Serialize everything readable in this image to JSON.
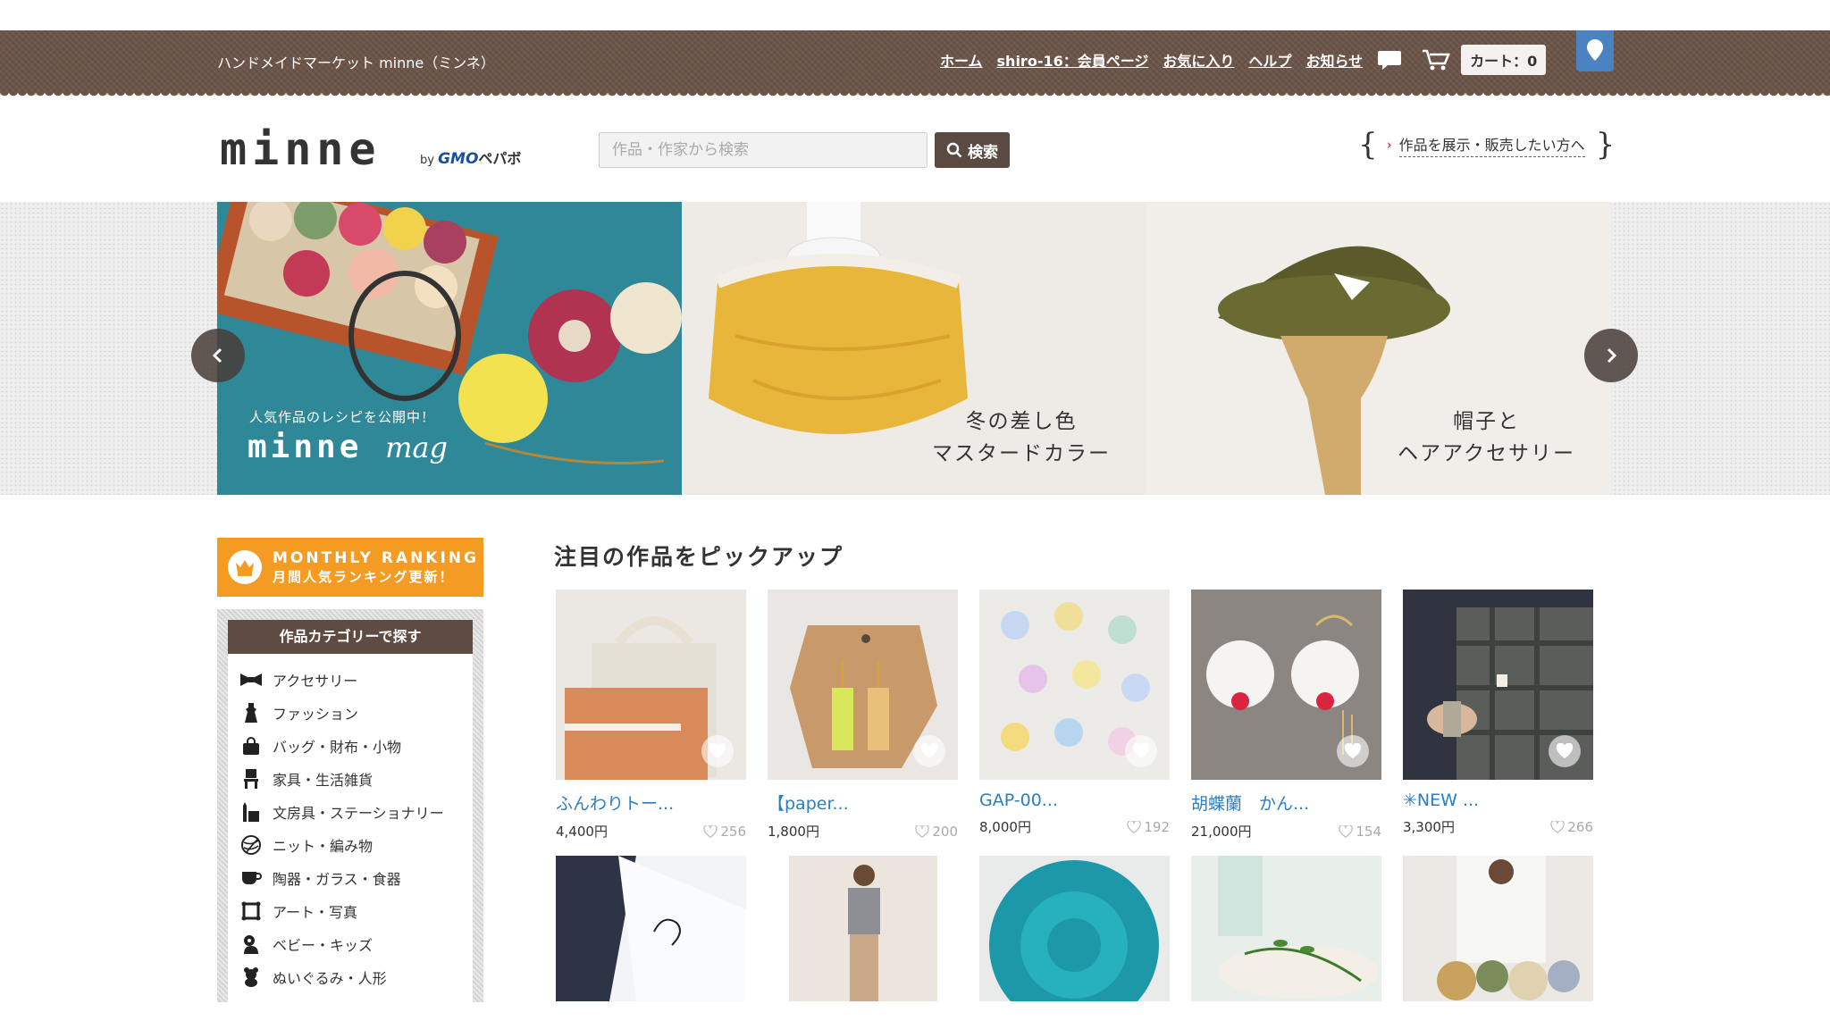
{
  "header": {
    "site_label": "ハンドメイドマーケット minne（ミンネ）",
    "nav": [
      {
        "label": "ホーム"
      },
      {
        "label": "shiro-16：会員ページ"
      },
      {
        "label": "お気に入り"
      },
      {
        "label": "ヘルプ"
      },
      {
        "label": "お知らせ"
      }
    ],
    "cart_label": "カート：0"
  },
  "logo": {
    "text": "minne",
    "by": "by",
    "gmo": "GMO",
    "pepabo": "ペパボ"
  },
  "search": {
    "placeholder": "作品・作家から検索",
    "button_label": "検索"
  },
  "sell_link": {
    "label": "作品を展示・販売したい方へ"
  },
  "hero": {
    "slides": [
      {
        "sub": "人気作品のレシピを公開中！",
        "logo": "minne",
        "logo_script": "mag"
      },
      {
        "caption_line1": "冬の差し色",
        "caption_line2": "マスタードカラー"
      },
      {
        "caption_line1": "帽子と",
        "caption_line2": "ヘアアクセサリー"
      }
    ]
  },
  "ranking_banner": {
    "en": "MONTHLY RANKING",
    "jp": "月間人気ランキング更新！"
  },
  "categories": {
    "title": "作品カテゴリーで探す",
    "items": [
      {
        "label": "アクセサリー",
        "icon": "ribbon-icon"
      },
      {
        "label": "ファッション",
        "icon": "dress-icon"
      },
      {
        "label": "バッグ・財布・小物",
        "icon": "bag-icon"
      },
      {
        "label": "家具・生活雑貨",
        "icon": "chair-icon"
      },
      {
        "label": "文房具・ステーショナリー",
        "icon": "stationery-icon"
      },
      {
        "label": "ニット・編み物",
        "icon": "yarn-icon"
      },
      {
        "label": "陶器・ガラス・食器",
        "icon": "cup-icon"
      },
      {
        "label": "アート・写真",
        "icon": "frame-icon"
      },
      {
        "label": "ベビー・キッズ",
        "icon": "baby-icon"
      },
      {
        "label": "ぬいぐるみ・人形",
        "icon": "bear-icon"
      }
    ]
  },
  "pickup": {
    "title": "注目の作品をピックアップ",
    "items": [
      {
        "title": "ふんわりトー...",
        "price": "4,400円",
        "likes": "256"
      },
      {
        "title": "【paper...",
        "price": "1,800円",
        "likes": "200"
      },
      {
        "title": "GAP-00...",
        "price": "8,000円",
        "likes": "192"
      },
      {
        "title": "胡蝶蘭　かん...",
        "price": "21,000円",
        "likes": "154"
      },
      {
        "title": "✳NEW ...",
        "price": "3,300円",
        "likes": "266"
      }
    ]
  },
  "colors": {
    "header_brown": "#6b5448",
    "accent_orange": "#f39b22",
    "link_blue": "#2a7ec1",
    "pin_blue": "#4a82c2"
  }
}
